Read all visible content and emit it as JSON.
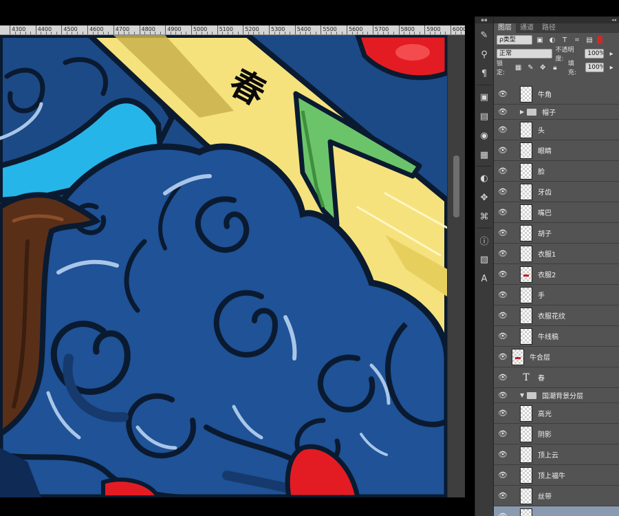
{
  "ruler": {
    "labels": [
      "4300",
      "4400",
      "4500",
      "4600",
      "4700",
      "4800",
      "4900",
      "5000",
      "5100",
      "5200",
      "5300",
      "5400",
      "5500",
      "5600",
      "5700",
      "5800",
      "5900",
      "6000"
    ]
  },
  "artwork": {
    "calligraphy_char": "春",
    "colors": {
      "cloud_blue": "#1c4a86",
      "cloud_dark": "#163a6e",
      "outline": "#0a1a30",
      "highlight": "#a9c6e8",
      "sky_cyan": "#26b5e8",
      "ribbon_yellow": "#f5e27d",
      "ribbon_shadow": "#c9b24c",
      "arrow_green": "#6cc46a",
      "arrow_dark": "#3f8f3c",
      "horn_brown": "#5a2f18",
      "red": "#e31c23"
    }
  },
  "panel": {
    "collapse_glyph": "◂◂",
    "tabs": [
      {
        "label": "图层",
        "active": true
      },
      {
        "label": "通道",
        "active": false
      },
      {
        "label": "路径",
        "active": false
      }
    ],
    "filter": {
      "label": "ρ类型",
      "icons": [
        "image-filter-icon",
        "adjustment-filter-icon",
        "type-filter-icon",
        "shape-filter-icon",
        "smart-filter-icon"
      ]
    },
    "blend_mode": "正常",
    "opacity": {
      "label": "不透明度:",
      "value": "100%"
    },
    "lock": {
      "label": "锁定:"
    },
    "fill": {
      "label": "填充:",
      "value": "100%"
    }
  },
  "layers": [
    {
      "name": "牛角",
      "type": "layer"
    },
    {
      "name": "帽子",
      "type": "group"
    },
    {
      "name": "头",
      "type": "layer"
    },
    {
      "name": "眼睛",
      "type": "layer"
    },
    {
      "name": "脸",
      "type": "layer"
    },
    {
      "name": "牙齿",
      "type": "layer"
    },
    {
      "name": "嘴巴",
      "type": "layer"
    },
    {
      "name": "胡子",
      "type": "layer"
    },
    {
      "name": "衣服1",
      "type": "layer"
    },
    {
      "name": "衣服2",
      "type": "layer",
      "mark": true
    },
    {
      "name": "手",
      "type": "layer"
    },
    {
      "name": "衣服花纹",
      "type": "layer"
    },
    {
      "name": "牛线稿",
      "type": "layer"
    },
    {
      "name": "牛合层",
      "type": "merged",
      "mark": true
    },
    {
      "name": "春",
      "type": "text"
    },
    {
      "name": "国潮背景分层",
      "type": "group-open"
    },
    {
      "name": "高光",
      "type": "layer"
    },
    {
      "name": "阴影",
      "type": "layer"
    },
    {
      "name": "顶上云",
      "type": "layer"
    },
    {
      "name": "顶上福牛",
      "type": "layer"
    },
    {
      "name": "丝带",
      "type": "layer"
    },
    {
      "name": "",
      "type": "layer",
      "selected": true
    }
  ],
  "tools": [
    "brush-icon",
    "clone-stamp-icon",
    "paragraph-icon",
    "navigator-icon",
    "info-icon",
    "color-icon",
    "swatches-icon",
    "adjustments-icon",
    "styles-icon",
    "history-icon",
    "actions-icon",
    "tool-presets-icon",
    "character-icon"
  ]
}
